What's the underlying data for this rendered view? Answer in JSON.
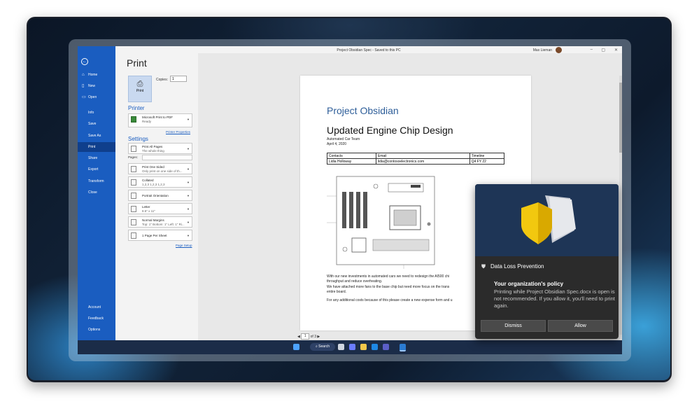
{
  "window": {
    "title": "Project Obsidian Spec  -  Saved to this PC",
    "user": "Max Lieman"
  },
  "sidebar": {
    "items": [
      {
        "label": "Home"
      },
      {
        "label": "New"
      },
      {
        "label": "Open"
      },
      {
        "label": "Info"
      },
      {
        "label": "Save"
      },
      {
        "label": "Save As"
      },
      {
        "label": "Print"
      },
      {
        "label": "Share"
      },
      {
        "label": "Export"
      },
      {
        "label": "Transform"
      },
      {
        "label": "Close"
      }
    ],
    "bottom": [
      {
        "label": "Account"
      },
      {
        "label": "Feedback"
      },
      {
        "label": "Options"
      }
    ]
  },
  "print_panel": {
    "heading": "Print",
    "print_button": "Print",
    "copies_label": "Copies:",
    "copies_value": "1",
    "printer_heading": "Printer",
    "printer_name": "Microsoft Print to PDF",
    "printer_status": "Ready",
    "printer_properties": "Printer Properties",
    "settings_heading": "Settings",
    "pages_label": "Pages:",
    "settings": [
      {
        "l1": "Print All Pages",
        "l2": "The whole thing"
      },
      {
        "l1": "Print One Sided",
        "l2": "Only print on one side of th..."
      },
      {
        "l1": "Collated",
        "l2": "1,2,3    1,2,3    1,2,3"
      },
      {
        "l1": "Portrait Orientation",
        "l2": ""
      },
      {
        "l1": "Letter",
        "l2": "8.5\" x 11\""
      },
      {
        "l1": "Normal Margins",
        "l2": "Top: 1\" Bottom: 1\" Left: 1\" Ri..."
      },
      {
        "l1": "1 Page Per Sheet",
        "l2": ""
      }
    ],
    "page_setup": "Page Setup"
  },
  "document": {
    "title": "Project Obsidian",
    "subtitle": "Updated Engine Chip Design",
    "team": "Automated Car Team",
    "date": "April 4, 2020",
    "table": {
      "headers": [
        "Contacts",
        "Email",
        "Timeline"
      ],
      "rows": [
        [
          "Lidia Holloway",
          "lidia@contosoelectronics.com",
          "Q4 FY 22"
        ]
      ]
    },
    "paragraph1_line1": "With our new investments in automated cars we need to redesign the AI500 chi",
    "paragraph1_line2": "throughput and reduce overheating.",
    "paragraph2_line1": "We have attached more fans to the base chip but need more focus on the trans",
    "paragraph2_line2": "entire board.",
    "paragraph3": "For any additional costs because of this please create a new expense form and u"
  },
  "pager": {
    "current": "1",
    "total": "of 3"
  },
  "taskbar": {
    "search_label": "Search"
  },
  "toast": {
    "app_name": "Data Loss Prevention",
    "title": "Your organization's policy",
    "body": "Printing while Project Obsidian Spec.docx is open is not recommended. If you allow it, you'll need to print again.",
    "dismiss": "Dismiss",
    "allow": "Allow"
  },
  "colors": {
    "accent": "#1a5dc0",
    "toast_bg": "#2b2b2b",
    "taskbar": "#1b2c48"
  }
}
